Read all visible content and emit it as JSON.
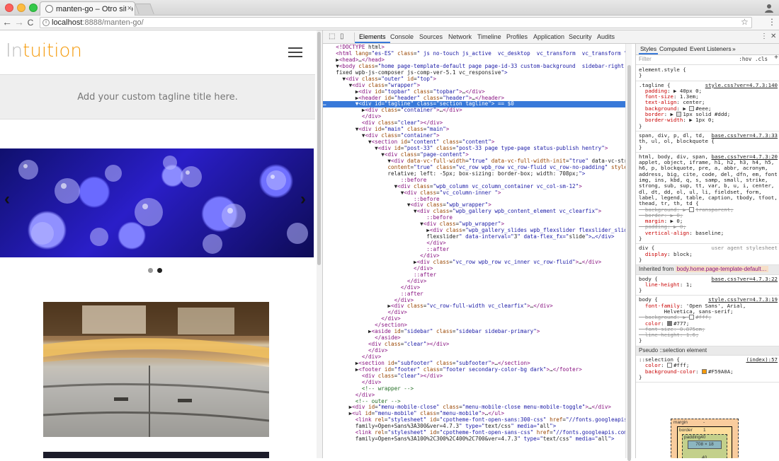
{
  "browser": {
    "tab_title": "manten-go – Otro sitio realizado",
    "tab_close": "×",
    "url_host": "localhost",
    "url_path": ":8888/manten-go/",
    "back": "←",
    "forward": "→",
    "reload": "C",
    "star": "☆",
    "menu": "⋮",
    "info": "i"
  },
  "site": {
    "logo_start": "In",
    "logo_accent": "tuition",
    "tagline": "Add your custom tagline title here.",
    "slide_prev": "‹",
    "slide_next": "›",
    "slide_count": 2,
    "active_slide": 2
  },
  "devtools": {
    "tools": {
      "inspect": "⬚",
      "device": "▯"
    },
    "tabs": [
      "Elements",
      "Console",
      "Sources",
      "Network",
      "Timeline",
      "Profiles",
      "Application",
      "Security",
      "Audits"
    ],
    "active_tab": "Elements",
    "menu": "⋮",
    "close": "✕",
    "element_lines": [
      "<!DOCTYPE html>",
      "<html lang=\"es-ES\" class=\" js no-touch js_active  vc_desktop  vc_transform  vc_transform \">",
      "▶<head>…</head>",
      "▼<body class=\"home page-template-default page page-id-33 custom-background  sidebar-right  wrapper-",
      "fixed wpb-js-composer js-comp-ver-5.1 vc_responsive\">",
      "  ▼<div class=\"outer\" id=\"top\">",
      "    ▼<div class=\"wrapper\">",
      "      ▶<div id=\"topbar\" class=\"topbar\">…</div>",
      "      ▶<header id=\"header\" class=\"header\">…</header>",
      "      ▼<div id=\"tagline\" class=\"section tagline\"> == $0",
      "        ▶<div class=\"container\">…</div>",
      "        </div>",
      "        <div class=\"clear\"></div>",
      "      ▼<div id=\"main\" class=\"main\">",
      "        ▼<div class=\"container\">",
      "          ▼<section id=\"content\" class=\"content\">",
      "            ▼<div id=\"post-33\" class=\"post-33 page type-page status-publish hentry\">",
      "              ▼<div class=\"page-content\">",
      "                ▼<div data-vc-full-width=\"true\" data-vc-full-width-init=\"true\" data-vc-stretch-",
      "                content=\"true\" class=\"vc_row wpb_row vc_row-fluid vc_row-no-padding\" style=\"position:",
      "                relative; left: -5px; box-sizing: border-box; width: 708px;\">",
      "                    ::before",
      "                  ▼<div class=\"wpb_column vc_column_container vc_col-sm-12\">",
      "                    ▼<div class=\"vc_column-inner \">",
      "                        ::before",
      "                      ▼<div class=\"wpb_wrapper\">",
      "                        ▼<div class=\"wpb_gallery wpb_content_element vc_clearfix\">",
      "                            ::before",
      "                          ▼<div class=\"wpb_wrapper\">",
      "                            ▶<div class=\"wpb_gallery_slides wpb_flexslider flexslider_slide",
      "                            flexslider\" data-interval=\"3\" data-flex_fx=\"slide\">…</div>",
      "                            </div>",
      "                            ::after",
      "                          </div>",
      "                        ▶<div class=\"vc_row wpb_row vc_inner vc_row-fluid\">…</div>",
      "                        </div>",
      "                        ::after",
      "                      </div>",
      "                    </div>",
      "                    ::after",
      "                  </div>",
      "                ▶<div class=\"vc_row-full-width vc_clearfix\">…</div>",
      "                </div>",
      "              </div>",
      "            </section>",
      "          ▶<aside id=\"sidebar\" class=\"sidebar sidebar-primary\">",
      "            </aside>",
      "          <div class=\"clear\"></div>",
      "          </div>",
      "        </div>",
      "      ▶<section id=\"subfooter\" class=\"subfooter\">…</section>",
      "      ▶<footer id=\"footer\" class=\"footer secondary-color-bg dark\">…</footer>",
      "        <div class=\"clear\"></div>",
      "        </div>",
      "        <!-- wrapper -->",
      "      </div>",
      "      <!-- outer -->",
      "    ▶<div id=\"menu-mobile-close\" class=\"menu-mobile-close menu-mobile-toggle\">…</div>",
      "    ▶<ul id=\"menu-mobile\" class=\"menu-mobile\">…</ul>",
      "      <link rel=\"stylesheet\" id=\"cpotheme-font-open-sans:300-css\" href=\"//fonts.googleapis.com/css?",
      "      family=Open+Sans%3A300&ver=4.7.3\" type=\"text/css\" media=\"all\">",
      "      <link rel=\"stylesheet\" id=\"cpotheme-font-open-sans-css\" href=\"//fonts.googleapis.com/css?",
      "      family=Open+Sans%3A100%2C300%2C400%2C700&ver=4.7.3\" type=\"text/css\" media=\"all\">"
    ],
    "selected_line": 9
  },
  "styles_panel": {
    "tabs": [
      "Styles",
      "Computed",
      "Event Listeners",
      "»"
    ],
    "active_tab": "Styles",
    "filter_placeholder": "Filter",
    "hov": ":hov",
    "cls": ".cls",
    "plus": "+",
    "element_style": "element.style {",
    "tagline_rule": {
      "selector": ".tagline {",
      "source": "style.css?ver=4.7.3:140",
      "props": [
        [
          "padding",
          "▶ 40px 0;"
        ],
        [
          "font-size",
          "1.3em;"
        ],
        [
          "text-align",
          "center;"
        ],
        [
          "background",
          "▶ #eee;"
        ],
        [
          "border",
          "▶ 1px solid #ddd;"
        ],
        [
          "border-width",
          "▶ 1px 0;"
        ]
      ],
      "swatches": {
        "background": "#eeeeee",
        "border": "#dddddd"
      }
    },
    "span_rule": {
      "selector": "span, div, p, dl, td,\nth, ul, ol, blockquote {",
      "source": "base.css?ver=4.7.3:33"
    },
    "html_rule": {
      "selector": "html, body, div, span,\napplet, object, iframe, h1, h2, h3, h4, h5,\nh6, p, blockquote, pre, a, abbr, acronym,\naddress, big, cite, code, del, dfn, em, font,\nimg, ins, kbd, q, s, samp, small, strike,\nstrong, sub, sup, tt, var, b, u, i, center,\ndl, dt, dd, ol, ul, li, fieldset, form,\nlabel, legend, table, caption, tbody, tfoot,\nthead, tr, th, td {",
      "source": "base.css?ver=4.7.3:20",
      "props": [
        [
          "background",
          "▶ transparent;",
          true
        ],
        [
          "border",
          "▶ 0;",
          true
        ],
        [
          "margin",
          "▶ 0;",
          false
        ],
        [
          "padding",
          "▶ 0;",
          true
        ],
        [
          "vertical-align",
          "baseline;",
          false
        ]
      ]
    },
    "div_rule": {
      "selector": "div {",
      "source": "user agent stylesheet",
      "props": [
        [
          "display",
          "block;"
        ]
      ]
    },
    "inherited_label": "Inherited from",
    "inherited_from": "body.home.page-template-default…",
    "body_rule_1": {
      "selector": "body {",
      "source": "base.css?ver=4.7.3:22",
      "props": [
        [
          "line-height",
          "1;"
        ]
      ]
    },
    "body_rule_2": {
      "selector": "body {",
      "source": "style.css?ver=4.7.3:19",
      "props": [
        [
          "font-family",
          "'Open Sans', Arial,\n      Helvetica, sans-serif;",
          false
        ],
        [
          "background",
          "▶ #fff;",
          true
        ],
        [
          "color",
          "#777;",
          false
        ],
        [
          "font-size",
          "0.875em;",
          true
        ],
        [
          "line-height",
          "1.6;",
          true
        ]
      ]
    },
    "pseudo_label": "Pseudo ::selection element",
    "selection_rule": {
      "selector": "::selection {",
      "source": "(index):57",
      "props": [
        [
          "color",
          "#fff;"
        ],
        [
          "background-color",
          "#F59A0A;"
        ]
      ],
      "swatches": {
        "color": "#ffffff",
        "background-color": "#f59a0a"
      }
    },
    "close_brace": "}",
    "box_model": {
      "margin_label": "margin",
      "margin_val": "-",
      "border_label": "border",
      "border_top": "1",
      "border_bottom": "1",
      "padding_label": "padding40",
      "padding_bottom": "40",
      "content": "708 × 18"
    }
  },
  "colors": {
    "accent": "#f59a0a",
    "selection": "#3879d9"
  }
}
